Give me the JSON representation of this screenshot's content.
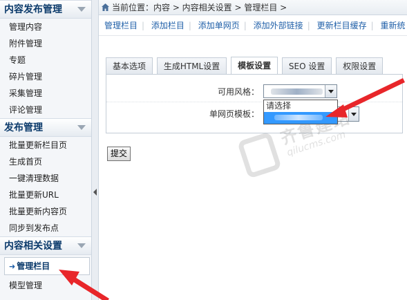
{
  "sidebar": {
    "sections": [
      {
        "title": "内容发布管理",
        "items": [
          "管理内容",
          "附件管理",
          "专题",
          "碎片管理",
          "采集管理",
          "评论管理"
        ]
      },
      {
        "title": "发布管理",
        "items": [
          "批量更新栏目页",
          "生成首页",
          "一键清理数据",
          "批量更新URL",
          "批量更新内容页",
          "同步到发布点"
        ]
      },
      {
        "title": "内容相关设置",
        "items": [
          "管理栏目",
          "模型管理"
        ],
        "active_index": 0
      }
    ]
  },
  "breadcrumb": {
    "text": "当前位置：内容 > 内容相关设置 > 管理栏目 >"
  },
  "toolbar": {
    "links": [
      "管理栏目",
      "添加栏目",
      "添加单网页",
      "添加外部链接",
      "更新栏目缓存",
      "重新统"
    ]
  },
  "tabs": [
    {
      "label": "基本选项",
      "active": false
    },
    {
      "label": "生成HTML设置",
      "active": false
    },
    {
      "label": "模板设置",
      "active": true
    },
    {
      "label": "SEO 设置",
      "active": false
    },
    {
      "label": "权限设置",
      "active": false
    }
  ],
  "form": {
    "style_label": "可用风格：",
    "page_template_label": "单网页模板：",
    "page_template_value_suffix": "ml",
    "dropdown_options": [
      "请选择"
    ]
  },
  "submit_label": "提交",
  "watermark": {
    "brand": "齐鲁建站",
    "url": "qilucms.com"
  },
  "colors": {
    "accent_blue": "#1f5fa8",
    "arrow_red": "#e8262a",
    "selection": "#3399ff"
  }
}
